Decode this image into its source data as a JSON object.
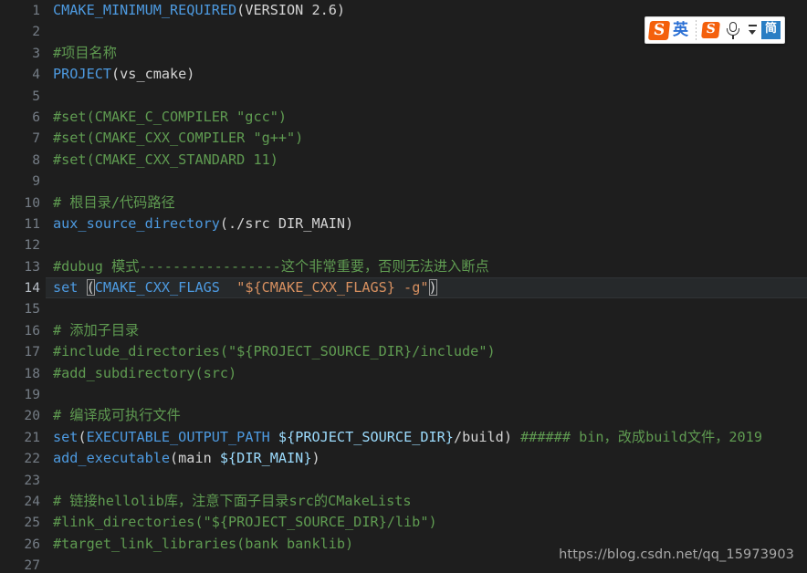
{
  "editor": {
    "language": "cmake",
    "theme": "dark",
    "background_color": "#1e1e1e",
    "active_line_color": "#26292b",
    "active_line_number": 14,
    "colors": {
      "function": "#4d9ae0",
      "comment": "#5f9b51",
      "string": "#d79060",
      "plain": "#d4d4d4",
      "variable": "#9cdcfe",
      "gutter": "#757d86"
    },
    "lines": [
      {
        "num": "1",
        "tokens": [
          {
            "t": "CMAKE_MINIMUM_REQUIRED",
            "c": "tk-fn"
          },
          {
            "t": "(VERSION 2.6)",
            "c": "tk-plain"
          }
        ]
      },
      {
        "num": "2",
        "tokens": []
      },
      {
        "num": "3",
        "tokens": [
          {
            "t": "#项目名称",
            "c": "tk-cmt"
          }
        ]
      },
      {
        "num": "4",
        "tokens": [
          {
            "t": "PROJECT",
            "c": "tk-fn"
          },
          {
            "t": "(vs_cmake)",
            "c": "tk-plain"
          }
        ]
      },
      {
        "num": "5",
        "tokens": []
      },
      {
        "num": "6",
        "tokens": [
          {
            "t": "#set(CMAKE_C_COMPILER \"gcc\")",
            "c": "tk-cmt"
          }
        ]
      },
      {
        "num": "7",
        "tokens": [
          {
            "t": "#set(CMAKE_CXX_COMPILER \"g++\")",
            "c": "tk-cmt"
          }
        ]
      },
      {
        "num": "8",
        "tokens": [
          {
            "t": "#set(CMAKE_CXX_STANDARD 11)",
            "c": "tk-cmt"
          }
        ]
      },
      {
        "num": "9",
        "tokens": []
      },
      {
        "num": "10",
        "tokens": [
          {
            "t": "# 根目录/代码路径",
            "c": "tk-cmt"
          }
        ]
      },
      {
        "num": "11",
        "tokens": [
          {
            "t": "aux_source_directory",
            "c": "tk-fn"
          },
          {
            "t": "(./src DIR_MAIN)",
            "c": "tk-plain"
          }
        ]
      },
      {
        "num": "12",
        "tokens": []
      },
      {
        "num": "13",
        "tokens": [
          {
            "t": "#dubug 模式-----------------这个非常重要，否则无法进入断点",
            "c": "tk-cmt"
          }
        ]
      },
      {
        "num": "14",
        "active": true,
        "tokens": [
          {
            "t": "set ",
            "c": "tk-fn"
          },
          {
            "t": "(",
            "c": "bracket"
          },
          {
            "t": "CMAKE_CXX_FLAGS",
            "c": "tk-fn"
          },
          {
            "t": "  ",
            "c": "tk-plain"
          },
          {
            "t": "\"${CMAKE_CXX_FLAGS} -g\"",
            "c": "tk-str"
          },
          {
            "t": ")",
            "c": "bracket"
          }
        ]
      },
      {
        "num": "15",
        "tokens": []
      },
      {
        "num": "16",
        "tokens": [
          {
            "t": "# 添加子目录",
            "c": "tk-cmt"
          }
        ]
      },
      {
        "num": "17",
        "tokens": [
          {
            "t": "#include_directories(\"${PROJECT_SOURCE_DIR}/include\")",
            "c": "tk-cmt"
          }
        ]
      },
      {
        "num": "18",
        "tokens": [
          {
            "t": "#add_subdirectory(src)",
            "c": "tk-cmt"
          }
        ]
      },
      {
        "num": "19",
        "tokens": []
      },
      {
        "num": "20",
        "tokens": [
          {
            "t": "# 编译成可执行文件",
            "c": "tk-cmt"
          }
        ]
      },
      {
        "num": "21",
        "tokens": [
          {
            "t": "set",
            "c": "tk-fn"
          },
          {
            "t": "(",
            "c": "tk-plain"
          },
          {
            "t": "EXECUTABLE_OUTPUT_PATH",
            "c": "tk-fn"
          },
          {
            "t": " ",
            "c": "tk-plain"
          },
          {
            "t": "${PROJECT_SOURCE_DIR}",
            "c": "tk-var"
          },
          {
            "t": "/build)",
            "c": "tk-plain"
          },
          {
            "t": " ###### bin，改成build文件，2019",
            "c": "tk-cmt"
          }
        ]
      },
      {
        "num": "22",
        "tokens": [
          {
            "t": "add_executable",
            "c": "tk-fn"
          },
          {
            "t": "(main ",
            "c": "tk-plain"
          },
          {
            "t": "${DIR_MAIN}",
            "c": "tk-var"
          },
          {
            "t": ")",
            "c": "tk-plain"
          }
        ]
      },
      {
        "num": "23",
        "tokens": []
      },
      {
        "num": "24",
        "tokens": [
          {
            "t": "# 链接hellolib库，注意下面子目录src的CMakeLists",
            "c": "tk-cmt"
          }
        ]
      },
      {
        "num": "25",
        "tokens": [
          {
            "t": "#link_directories(\"${PROJECT_SOURCE_DIR}/lib\")",
            "c": "tk-cmt"
          }
        ]
      },
      {
        "num": "26",
        "tokens": [
          {
            "t": "#target_link_libraries(bank banklib)",
            "c": "tk-cmt"
          }
        ]
      },
      {
        "num": "27",
        "tokens": []
      }
    ]
  },
  "ime": {
    "name": "sogou-input-method",
    "logo_text": "S",
    "mode_label": "英",
    "logo_color": "#f4600c",
    "mode_color": "#2a6fd4",
    "keyboard_label": "简",
    "keyboard_color": "#2a7ec4"
  },
  "watermark": {
    "text": "https://blog.csdn.net/qq_15973903"
  }
}
